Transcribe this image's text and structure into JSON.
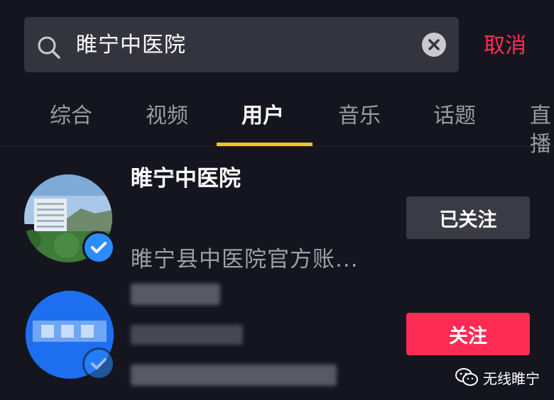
{
  "search": {
    "query": "睢宁中医院",
    "cancel_label": "取消"
  },
  "tabs": [
    {
      "label": "综合",
      "active": false
    },
    {
      "label": "视频",
      "active": false
    },
    {
      "label": "用户",
      "active": true
    },
    {
      "label": "音乐",
      "active": false
    },
    {
      "label": "话题",
      "active": false
    },
    {
      "label": "直播",
      "active": false
    }
  ],
  "results": [
    {
      "name": "睢宁中医院",
      "description": "睢宁县中医院官方账...",
      "verified": true,
      "button_label": "已关注"
    },
    {
      "verified": true,
      "button_label": "关注"
    }
  ],
  "watermark": {
    "text": "无线睢宁"
  },
  "colors": {
    "accent": "#fe2c55",
    "tab_indicator": "#f5c518",
    "verified": "#2c8cff"
  }
}
